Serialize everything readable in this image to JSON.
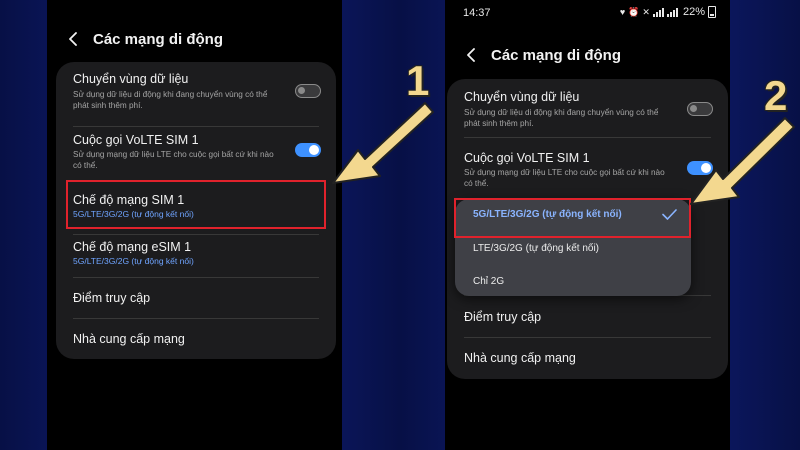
{
  "left_screen": {
    "title": "Các mạng di động",
    "roaming": {
      "title": "Chuyển vùng dữ liệu",
      "description": "Sử dụng dữ liệu di động khi đang chuyển vùng có thể phát sinh thêm phí.",
      "toggle_state": "off"
    },
    "volte": {
      "title": "Cuộc gọi VoLTE SIM 1",
      "description": "Sử dụng mạng dữ liệu LTE cho cuộc gọi bất cứ khi nào có thể.",
      "toggle_state": "on"
    },
    "network_mode_sim1": {
      "title": "Chế độ mạng SIM 1",
      "value": "5G/LTE/3G/2G (tự động kết nối)"
    },
    "network_mode_esim1": {
      "title": "Chế độ mạng eSIM 1",
      "value": "5G/LTE/3G/2G (tự động kết nối)"
    },
    "access_point": "Điểm truy cập",
    "network_operators": "Nhà cung cấp mạng"
  },
  "right_screen": {
    "status": {
      "time": "14:37",
      "battery": "22%",
      "icons": [
        "heart-icon",
        "alarm-icon",
        "mute-icon",
        "signal-icon",
        "battery-icon"
      ]
    },
    "title": "Các mạng di động",
    "roaming": {
      "title": "Chuyển vùng dữ liệu",
      "description": "Sử dụng dữ liệu di động khi đang chuyển vùng có thể phát sinh thêm phí.",
      "toggle_state": "off"
    },
    "volte": {
      "title": "Cuộc gọi VoLTE SIM 1",
      "description": "Sử dụng mạng dữ liệu LTE cho cuộc gọi bất cứ khi nào có thể."
    },
    "dropdown": {
      "options": [
        "5G/LTE/3G/2G (tự động kết nối)",
        "LTE/3G/2G (tự động kết nối)",
        "Chỉ 2G"
      ],
      "selected": "5G/LTE/3G/2G (tự động kết nối)"
    },
    "access_point": "Điểm truy cập",
    "network_operators": "Nhà cung cấp mạng"
  },
  "annotations": {
    "step1": "1",
    "step2": "2"
  },
  "colors": {
    "background": "#0d1a63",
    "accent_blue": "#3e91ff",
    "value_blue": "#6fa4ff",
    "highlight_red": "#e0222c",
    "arrow_yellow": "#f3d88f"
  }
}
